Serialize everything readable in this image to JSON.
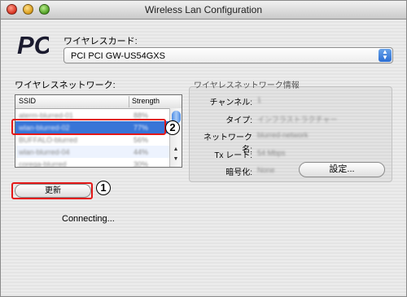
{
  "window": {
    "title": "Wireless Lan Configuration"
  },
  "card": {
    "label": "ワイヤレスカード:",
    "selected": "PCI PCI GW-US54GXS"
  },
  "network": {
    "label": "ワイヤレスネットワーク:",
    "columns": {
      "ssid": "SSID",
      "strength": "Strength"
    },
    "rows": [
      {
        "ssid": "aterm-blurred-01",
        "strength": "88%"
      },
      {
        "ssid": "wlan-blurred-02",
        "strength": "77%"
      },
      {
        "ssid": "BUFFALO-blurred",
        "strength": "56%"
      },
      {
        "ssid": "wlan-blurred-04",
        "strength": "44%"
      },
      {
        "ssid": "corega-blurred",
        "strength": "30%"
      },
      {
        "ssid": "ap-blurred-06",
        "strength": "21%"
      }
    ],
    "selected_index": 1
  },
  "refresh_button": "更新",
  "status": "Connecting...",
  "info": {
    "label": "ワイヤレスネットワーク情報",
    "fields": [
      {
        "label": "チャンネル:",
        "value": "1"
      },
      {
        "label": "タイプ:",
        "value": "インフラストラクチャー"
      },
      {
        "label": "ネットワーク名:",
        "value": "blurred-network"
      },
      {
        "label": "Tx レート:",
        "value": "54 Mbps"
      },
      {
        "label": "暗号化:",
        "value": "None"
      }
    ],
    "settings_button": "設定..."
  },
  "callouts": {
    "first": "1",
    "second": "2"
  },
  "colors": {
    "highlight": "#e41818",
    "selection": "#3875d7",
    "accent": "#2a6dd3"
  },
  "icons": {
    "logo": "pci-logo"
  }
}
